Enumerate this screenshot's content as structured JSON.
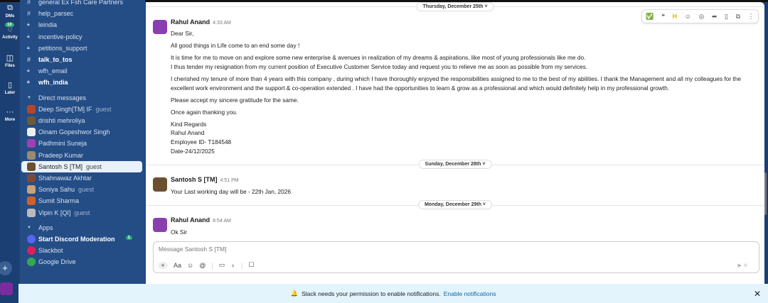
{
  "rail": {
    "items": [
      {
        "label": "DMs",
        "icon": "chat-bubbles-icon"
      },
      {
        "label": "Activity",
        "icon": "bell-icon",
        "badge": "10"
      },
      {
        "label": "Files",
        "icon": "files-icon"
      },
      {
        "label": "Later",
        "icon": "bookmark-icon"
      },
      {
        "label": "More",
        "icon": "more-icon"
      }
    ]
  },
  "sidebar": {
    "channels": [
      {
        "sym": "#",
        "label": "general  Ex Fsh Care Partners",
        "bold": false
      },
      {
        "sym": "#",
        "label": "help_parsec",
        "bold": false
      },
      {
        "sym": "🔒",
        "label": "leindia",
        "bold": false
      },
      {
        "sym": "🔒",
        "label": "incentive-policy",
        "bold": false
      },
      {
        "sym": "🔒",
        "label": "petitions_support",
        "bold": false
      },
      {
        "sym": "#",
        "label": "talk_to_tos",
        "bold": true
      },
      {
        "sym": "🔒",
        "label": "wfh_email",
        "bold": false
      },
      {
        "sym": "🔒",
        "label": "wfh_india",
        "bold": true
      }
    ],
    "dm_header": "Direct messages",
    "dms": [
      {
        "label": "Deep Singh[TM] IF",
        "guest": "guest",
        "color": "#b5452a"
      },
      {
        "label": "drishti mehroliya",
        "guest": "",
        "color": "#6b5a3a"
      },
      {
        "label": "Oinam Gopeshwor Singh",
        "guest": "",
        "color": "#eee"
      },
      {
        "label": "Padhmini Suneja",
        "guest": "",
        "color": "#a040b0"
      },
      {
        "label": "Pradeep Kumar",
        "guest": "",
        "color": "#9a8b70"
      },
      {
        "label": "Santosh S [TM]",
        "guest": "guest",
        "color": "#6b5030"
      },
      {
        "label": "Shahnawaz Akhtar",
        "guest": "",
        "color": "#7a4a3a"
      },
      {
        "label": "Soniya Sahu",
        "guest": "guest",
        "color": "#c9a27a"
      },
      {
        "label": "Sumit Sharma",
        "guest": "",
        "color": "#d0602a"
      },
      {
        "label": "Vipin K [QI]",
        "guest": "guest",
        "color": "#bbb"
      }
    ],
    "apps_header": "Apps",
    "apps": [
      {
        "label": "Start Discord Moderation",
        "badge": "1",
        "bold": true,
        "color": "#5865f2"
      },
      {
        "label": "Slackbot",
        "color": "#e01e5a"
      },
      {
        "label": "Google Drive",
        "color": "#34a853"
      }
    ]
  },
  "main": {
    "dates": [
      "Thursday, December 25th",
      "Sunday, December 28th",
      "Monday, December 29th"
    ],
    "messages": [
      {
        "author": "Rahul Anand",
        "time": "4:33 AM",
        "lines": [
          "Dear Sir,",
          "All good things in Life come to an end some day !",
          "It is time for me to move on and explore some new enterprise & avenues in realization of my dreams & aspirations, like most of young professionals like me do.",
          "I thus tender my resignation from my current position of Executive Customer Service today and request you to relieve me as soon as possible from my services.",
          "I cherished my  tenure of more than 4 years with this company , during which I have thoroughly enjoyed the responsibilities assigned to me to the best of my abilities.  I thank the Management and all my colleagues for the",
          "excellent work environment and the support & co-operation extended .   I have had the opportunities to learn & grow as a professional and which would definitely help in my professional growth.",
          "Please accept my sincere gratitude for the same.",
          "Once again thanking you.",
          "Kind Regards",
          "Rahul Anand",
          "Employee ID- T184548",
          "Date-24/12/2025"
        ]
      },
      {
        "author": "Santosh S [TM]",
        "time": "4:51 PM",
        "lines": [
          "Your Last working day will be - 22th Jan, 2026"
        ]
      },
      {
        "author": "Rahul Anand",
        "time": "8:54 AM",
        "lines": [
          "Ok Sir"
        ]
      }
    ],
    "composer_placeholder": "Message Santosh S [TM]",
    "composer_format": "Aa"
  },
  "notification": {
    "text": "Slack needs your permission to enable notifications.",
    "link": "Enable notifications"
  }
}
